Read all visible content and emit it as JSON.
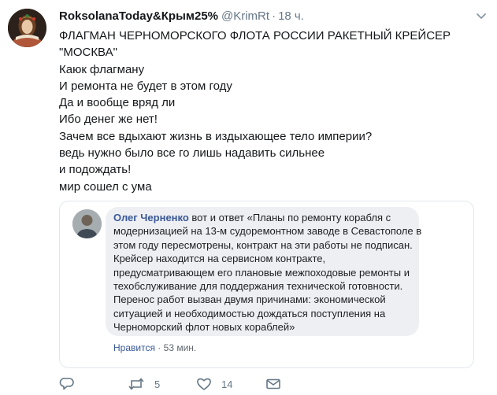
{
  "tweet": {
    "author_name": "RoksolanaToday&Крым25%",
    "handle": "@KrimRt",
    "separator": "·",
    "time": "18 ч.",
    "lines": [
      "ФЛАГМАН ЧЕРНОМОРСКОГО ФЛОТА РОССИИ РАКЕТНЫЙ КРЕЙСЕР",
      "\"МОСКВА\"",
      "Каюк флагману",
      "И ремонта не будет в этом году",
      "Да и вообще вряд ли",
      "Ибо денег же нет!",
      "Зачем все вдыхают жизнь в издыхающее тело империи?",
      "ведь нужно было все го лишь надавить сильнее",
      "и подождать!",
      "мир сошел с ума"
    ]
  },
  "quoted_comment": {
    "author": "Олег Черненко",
    "lines": [
      " вот и ответ «Планы по ремонту корабля с",
      "модернизацией на 13-м судоремонтном заводе в Севастополе в",
      "этом году пересмотрены, контракт на эти работы не подписан.",
      "Крейсер находится на сервисном контракте,",
      "предусматривающем его плановые межпоходовые ремонты и",
      "техобслуживание для поддержания технической готовности.",
      "Перенос работ вызван двумя причинами: экономической",
      "ситуацией и необходимостью дождаться поступления на",
      "Черноморский флот новых кораблей»"
    ],
    "like_label": "Нравится",
    "separator": "·",
    "time": "53 мин."
  },
  "actions": {
    "reply_icon": "reply-icon",
    "retweet_icon": "retweet-icon",
    "retweet_count": "5",
    "like_icon": "heart-icon",
    "like_count": "14",
    "dm_icon": "envelope-icon"
  },
  "colors": {
    "text": "#14171a",
    "muted": "#657786",
    "fb_link": "#385898",
    "bubble": "#eeeff2",
    "border": "#e1e8ed"
  }
}
